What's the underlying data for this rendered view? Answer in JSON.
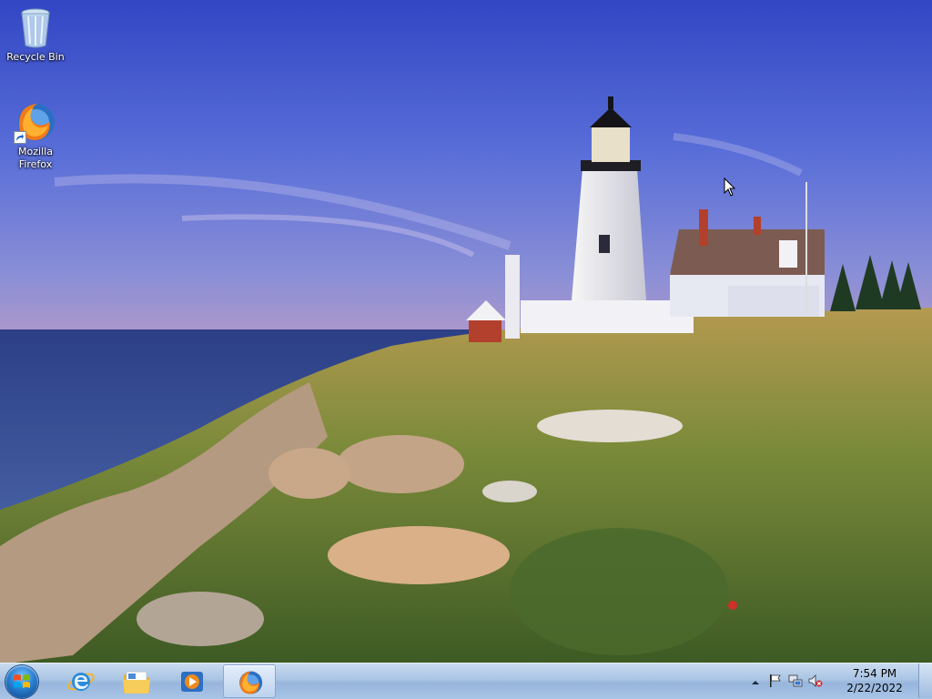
{
  "desktop": {
    "icons": [
      {
        "label": "Recycle Bin",
        "icon": "recycle-bin-icon"
      },
      {
        "label": "Mozilla\nFirefox",
        "icon": "firefox-icon"
      }
    ]
  },
  "taskbar": {
    "start": {
      "icon": "windows-logo-icon"
    },
    "pinned": [
      {
        "icon": "internet-explorer-icon"
      },
      {
        "icon": "folder-icon"
      },
      {
        "icon": "media-player-icon"
      },
      {
        "icon": "firefox-icon",
        "active": true
      }
    ]
  },
  "tray": {
    "time": "7:54 PM",
    "date": "2/22/2022",
    "icons": [
      "chevron-up-icon",
      "action-center-flag-icon",
      "network-icon",
      "volume-muted-icon"
    ]
  },
  "colors": {
    "sky_top": "#3b4fc9",
    "sea": "#2c4a8e",
    "taskbar": "#a9c4e4"
  }
}
